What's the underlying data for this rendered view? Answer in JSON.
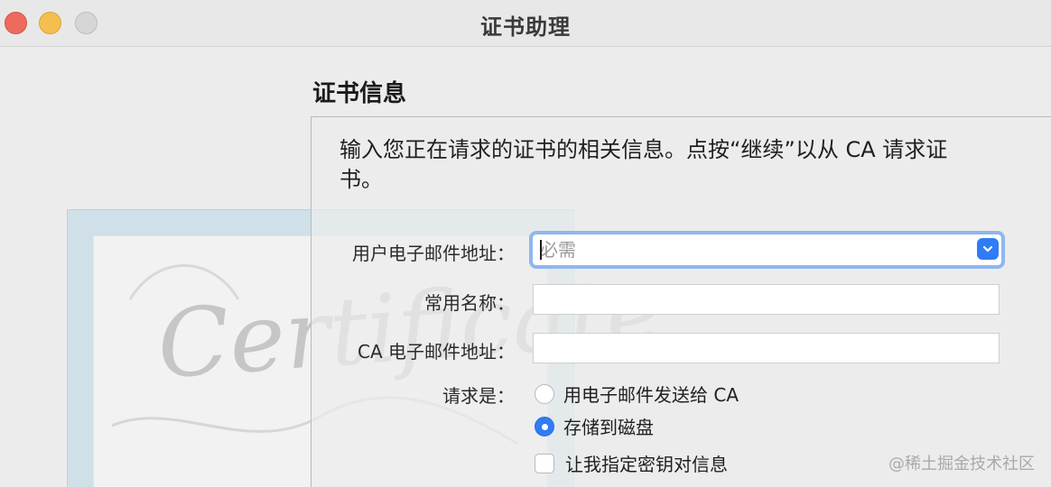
{
  "window": {
    "title": "证书助理"
  },
  "section": {
    "title": "证书信息",
    "description": "输入您正在请求的证书的相关信息。点按“继续”以从 CA 请求证书。"
  },
  "art": {
    "script_text": "Certificate"
  },
  "form": {
    "email": {
      "label": "用户电子邮件地址：",
      "value": "",
      "placeholder": "必需"
    },
    "common_name": {
      "label": "常用名称：",
      "value": ""
    },
    "ca_email": {
      "label": "CA 电子邮件地址：",
      "value": ""
    },
    "request": {
      "label": "请求是：",
      "options": [
        {
          "label": "用电子邮件发送给 CA",
          "selected": false
        },
        {
          "label": "存储到磁盘",
          "selected": true
        }
      ]
    },
    "custom_key": {
      "label": "让我指定密钥对信息",
      "checked": false
    }
  },
  "watermark": {
    "text": "@稀土掘金技术社区"
  },
  "colors": {
    "accent": "#2f7cf6",
    "focus_ring": "#8fb6ef",
    "close": "#ed6a5e",
    "minimize": "#f5bf4f",
    "zoom_disabled": "#d6d6d6"
  }
}
